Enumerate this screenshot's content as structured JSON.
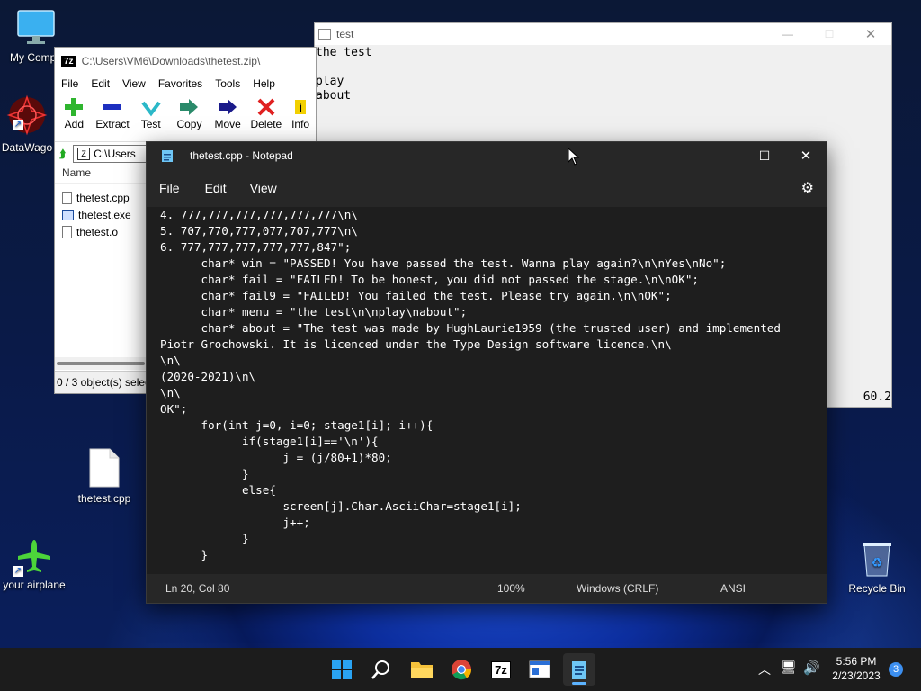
{
  "desktop": {
    "icons": [
      {
        "label": "My Compu"
      },
      {
        "label": "DataWago"
      },
      {
        "label": "thetest.cpp"
      },
      {
        "label": "your airplane"
      },
      {
        "label": "Recycle Bin"
      }
    ]
  },
  "console": {
    "title": "test",
    "lines": [
      "the test",
      "",
      "play",
      "about"
    ],
    "corner_value": "60.2"
  },
  "zip": {
    "path": "C:\\Users\\VM6\\Downloads\\thetest.zip\\",
    "menu": [
      "File",
      "Edit",
      "View",
      "Favorites",
      "Tools",
      "Help"
    ],
    "tools": [
      {
        "label": "Add",
        "icon": "plus-icon"
      },
      {
        "label": "Extract",
        "icon": "minus-icon"
      },
      {
        "label": "Test",
        "icon": "check-icon"
      },
      {
        "label": "Copy",
        "icon": "copy-arrow-icon"
      },
      {
        "label": "Move",
        "icon": "move-arrow-icon"
      },
      {
        "label": "Delete",
        "icon": "delete-x-icon"
      },
      {
        "label": "Info",
        "icon": "info-icon"
      }
    ],
    "address": "C:\\Users",
    "column_name": "Name",
    "files": [
      "thetest.cpp",
      "thetest.exe",
      "thetest.o"
    ],
    "status": "0 / 3 object(s) selec"
  },
  "notepad": {
    "title": "thetest.cpp - Notepad",
    "menu": [
      "File",
      "Edit",
      "View"
    ],
    "code": "4. 777,777,777,777,777,777\\n\\\n5. 707,770,777,077,707,777\\n\\\n6. 777,777,777,777,777,847\";\n      char* win = \"PASSED! You have passed the test. Wanna play again?\\n\\nYes\\nNo\";\n      char* fail = \"FAILED! To be honest, you did not passed the stage.\\n\\nOK\";\n      char* fail9 = \"FAILED! You failed the test. Please try again.\\n\\nOK\";\n      char* menu = \"the test\\n\\nplay\\nabout\";\n      char* about = \"The test was made by HughLaurie1959 (the trusted user) and implemented\nPiotr Grochowski. It is licenced under the Type Design software licence.\\n\\\n\\n\\\n(2020-2021)\\n\\\n\\n\\\nOK\";\n      for(int j=0, i=0; stage1[i]; i++){\n            if(stage1[i]=='\\n'){\n                  j = (j/80+1)*80;\n            }\n            else{\n                  screen[j].Char.AsciiChar=stage1[i];\n                  j++;\n            }\n      }",
    "status": {
      "position": "Ln 20, Col 80",
      "zoom": "100%",
      "line_ending": "Windows (CRLF)",
      "encoding": "ANSI"
    }
  },
  "taskbar": {
    "icons": [
      "windows-start-icon",
      "search-icon",
      "file-explorer-icon",
      "chrome-icon",
      "7zip-icon",
      "window-app-icon",
      "notepad-icon"
    ],
    "time": "5:56 PM",
    "date": "2/23/2023",
    "notification_count": "3"
  }
}
